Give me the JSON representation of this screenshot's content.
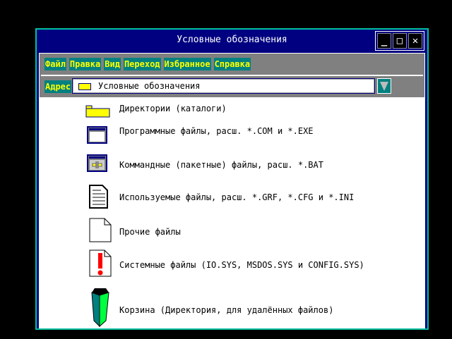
{
  "window": {
    "title": "Условные обозначения",
    "minimize": "_",
    "maximize": "□",
    "close": "✕"
  },
  "menu": [
    "Файл",
    "Правка",
    "Вид",
    "Переход",
    "Избранное",
    "Справка"
  ],
  "address": {
    "label": "Адрес",
    "value": "Условные обозначения"
  },
  "legend": [
    {
      "icon": "folder-icon",
      "label": "Директории (каталоги)"
    },
    {
      "icon": "program-window-icon",
      "label": "Программные файлы, расш. *.COM и *.EXE"
    },
    {
      "icon": "batch-file-icon",
      "label": "Коммандные (пакетные) файлы, расш. *.BAT"
    },
    {
      "icon": "text-document-icon",
      "label": "Используемые файлы, расш. *.GRF, *.CFG и *.INI"
    },
    {
      "icon": "blank-file-icon",
      "label": "Прочие файлы"
    },
    {
      "icon": "system-file-icon",
      "label": "Системные файлы (IO.SYS, MSDOS.SYS и CONFIG.SYS)"
    },
    {
      "icon": "recycle-bin-icon",
      "label": "Корзина (Директория, для удалённых файлов)"
    }
  ]
}
